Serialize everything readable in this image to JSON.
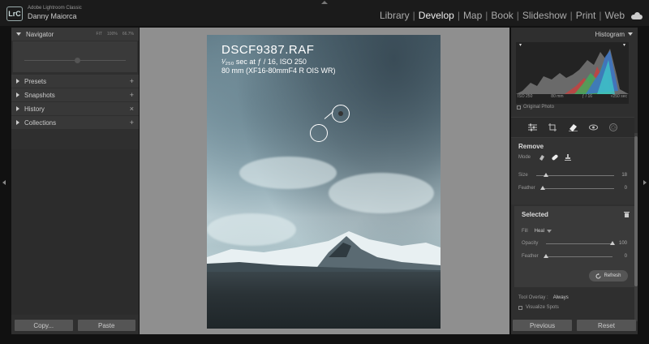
{
  "app": {
    "logo_text": "LrC",
    "app_name": "Adobe Lightroom Classic",
    "user_name": "Danny Maiorca"
  },
  "modules": [
    {
      "label": "Library",
      "active": false
    },
    {
      "label": "Develop",
      "active": true
    },
    {
      "label": "Map",
      "active": false
    },
    {
      "label": "Book",
      "active": false
    },
    {
      "label": "Slideshow",
      "active": false
    },
    {
      "label": "Print",
      "active": false
    },
    {
      "label": "Web",
      "active": false
    }
  ],
  "module_separator": "|",
  "left_panel": {
    "navigator": {
      "label": "Navigator",
      "zoom_options": [
        "FIT",
        "100%",
        "66.7%"
      ]
    },
    "sections": [
      {
        "label": "Presets",
        "action": "+"
      },
      {
        "label": "Snapshots",
        "action": "+"
      },
      {
        "label": "History",
        "action": "×"
      },
      {
        "label": "Collections",
        "action": "+"
      }
    ],
    "copy_button": "Copy...",
    "paste_button": "Paste"
  },
  "photo_overlay": {
    "filename": "DSCF9387.RAF",
    "exposure": "¹⁄₂₅₀ sec at ƒ / 16, ISO 250",
    "lens": "80 mm (XF16-80mmF4 R OIS WR)"
  },
  "right_panel": {
    "histogram_label": "Histogram",
    "hist_info": [
      "ISO 250",
      "80 mm",
      "ƒ / 16",
      "¹⁄250 sec"
    ],
    "original_photo_label": "Original Photo",
    "tools": [
      "edit-sliders-icon",
      "crop-icon",
      "eraser-icon",
      "red-eye-icon",
      "masking-icon"
    ],
    "remove": {
      "title": "Remove",
      "mode_label": "Mode",
      "size_label": "Size",
      "size_value": "18",
      "size_fraction": 0.12,
      "feather_label": "Feather",
      "feather_value": "0",
      "feather_fraction": 0.0
    },
    "selected": {
      "title": "Selected",
      "fill_label": "Fill",
      "fill_value": "Heal",
      "opacity_label": "Opacity",
      "opacity_value": "100",
      "opacity_fraction": 1.0,
      "feather_label": "Feather",
      "feather_value": "0",
      "feather_fraction": 0.0,
      "refresh_label": "Refresh"
    },
    "tool_overlay_label": "Tool Overlay :",
    "tool_overlay_value": "Always",
    "visualize_spots_label": "Visualize Spots",
    "previous_button": "Previous",
    "reset_button": "Reset"
  },
  "colors": {
    "panel_bg": "#2f2f2f",
    "canvas_bg": "#8f8f8f",
    "active_module": "#eeeeee"
  }
}
